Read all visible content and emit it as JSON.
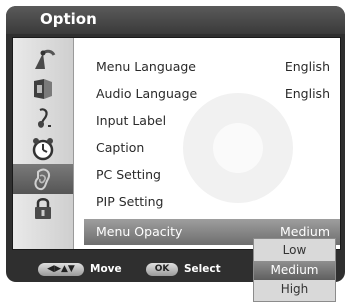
{
  "window": {
    "title": "Option"
  },
  "menu": {
    "items": [
      {
        "label": "Menu Language",
        "value": "English"
      },
      {
        "label": "Audio Language",
        "value": "English"
      },
      {
        "label": "Input Label",
        "value": ""
      },
      {
        "label": "Caption",
        "value": ""
      },
      {
        "label": "PC Setting",
        "value": ""
      },
      {
        "label": "PIP Setting",
        "value": ""
      },
      {
        "label": "Menu Opacity",
        "value": "Medium",
        "selected": true
      }
    ]
  },
  "sidebar": {
    "icons": [
      "antenna-icon",
      "picture-icon",
      "sound-icon",
      "clock-icon",
      "option-icon",
      "lock-icon"
    ],
    "active_index": 4
  },
  "dropdown": {
    "options": [
      "Low",
      "Medium",
      "High"
    ],
    "selected": "Medium"
  },
  "help_bar": {
    "move_key": "◀▶▲▼",
    "move_label": "Move",
    "select_key": "OK",
    "select_label": "Select"
  },
  "colors": {
    "frame": "#2f2f2f",
    "highlight": "#7a7a7a",
    "panel": "#ffffff"
  }
}
